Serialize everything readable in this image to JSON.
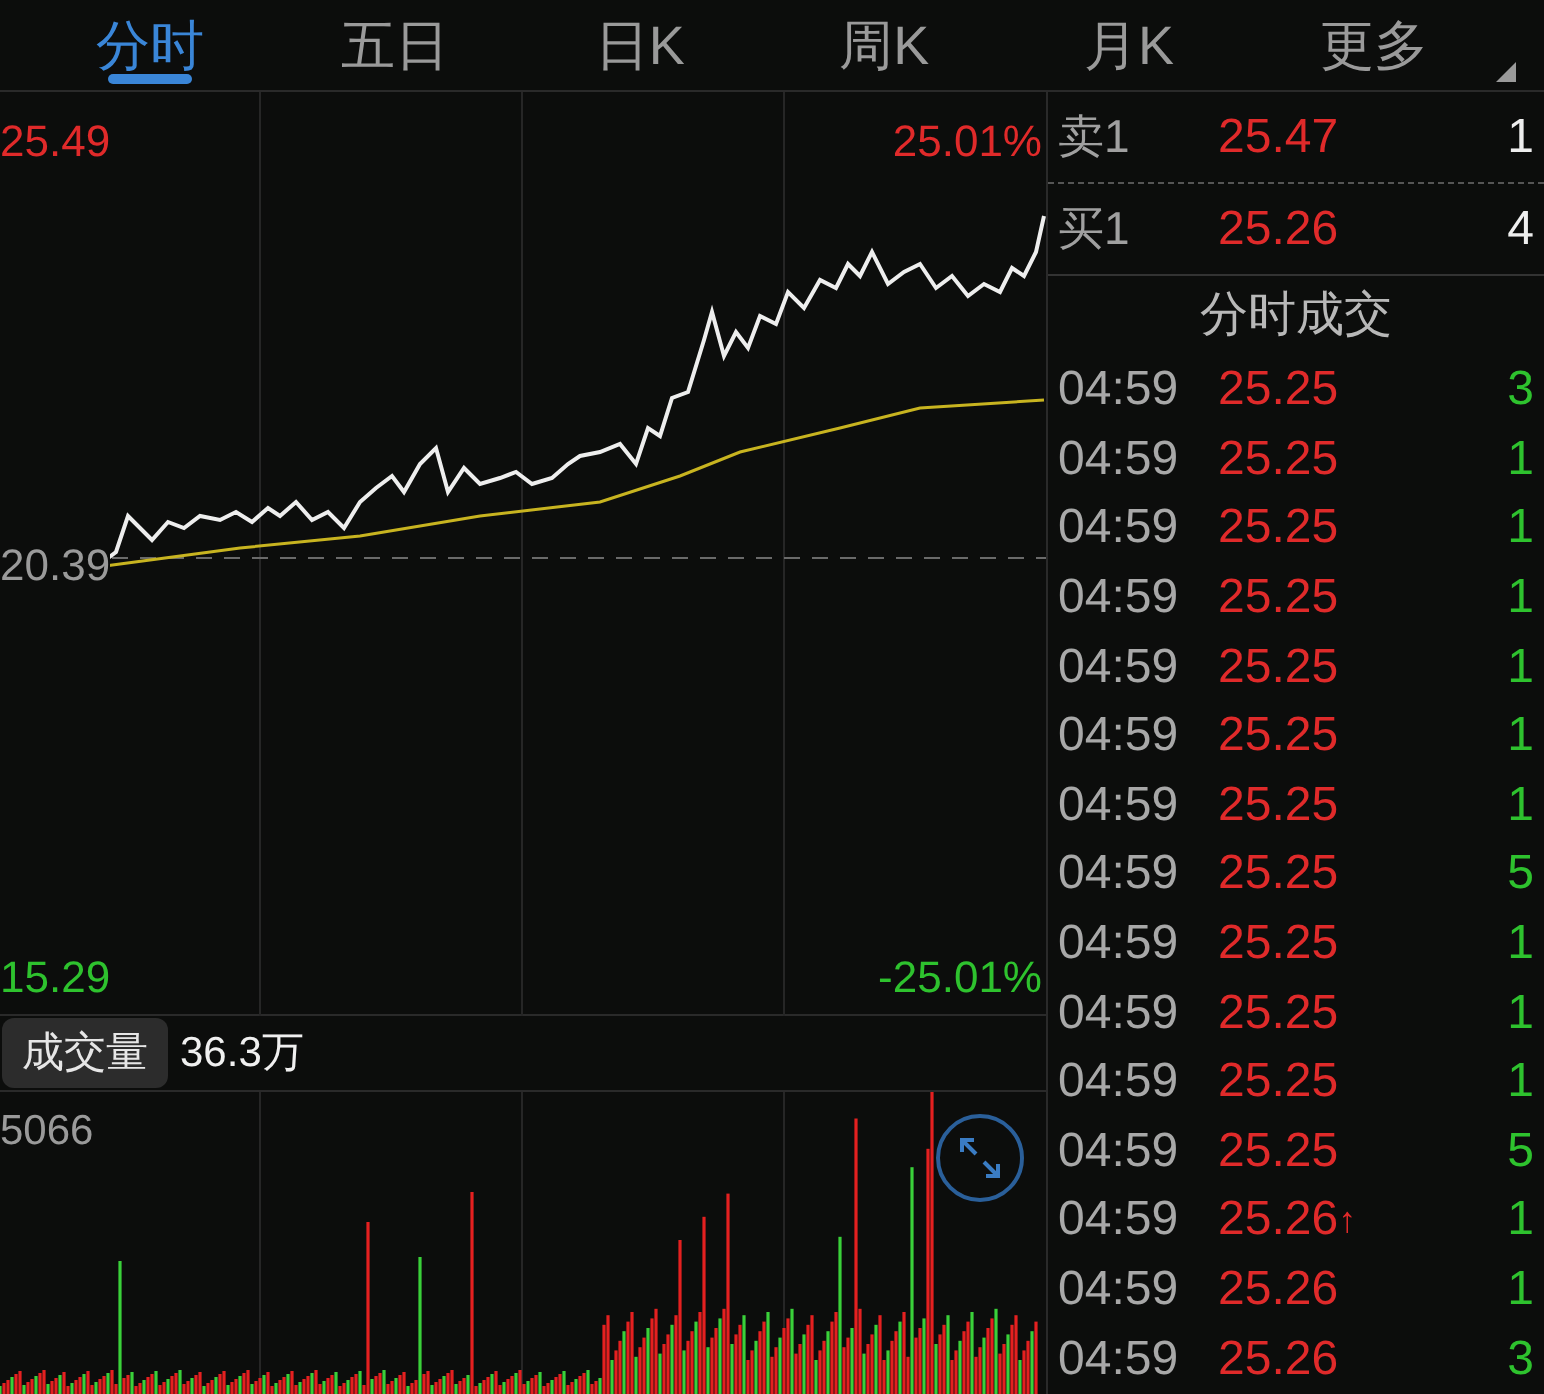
{
  "tabs": [
    {
      "label": "分时",
      "selected": true
    },
    {
      "label": "五日",
      "selected": false
    },
    {
      "label": "日K",
      "selected": false
    },
    {
      "label": "周K",
      "selected": false
    },
    {
      "label": "月K",
      "selected": false
    },
    {
      "label": "更多",
      "selected": false,
      "kind": "menu"
    }
  ],
  "price_chart": {
    "high": "25.49",
    "high_pct": "25.01%",
    "mid": "20.39",
    "low": "15.29",
    "low_pct": "-25.01%"
  },
  "volume": {
    "label": "成交量",
    "total": "36.3万",
    "max": "5066"
  },
  "quotes": [
    {
      "label": "卖1",
      "price": "25.47",
      "qty": "1"
    },
    {
      "label": "买1",
      "price": "25.26",
      "qty": "4"
    }
  ],
  "trades_title": "分时成交",
  "trades": [
    {
      "time": "04:59",
      "price": "25.25",
      "qty": "3"
    },
    {
      "time": "04:59",
      "price": "25.25",
      "qty": "1"
    },
    {
      "time": "04:59",
      "price": "25.25",
      "qty": "1"
    },
    {
      "time": "04:59",
      "price": "25.25",
      "qty": "1"
    },
    {
      "time": "04:59",
      "price": "25.25",
      "qty": "1"
    },
    {
      "time": "04:59",
      "price": "25.25",
      "qty": "1"
    },
    {
      "time": "04:59",
      "price": "25.25",
      "qty": "1"
    },
    {
      "time": "04:59",
      "price": "25.25",
      "qty": "5"
    },
    {
      "time": "04:59",
      "price": "25.25",
      "qty": "1"
    },
    {
      "time": "04:59",
      "price": "25.25",
      "qty": "1"
    },
    {
      "time": "04:59",
      "price": "25.25",
      "qty": "1"
    },
    {
      "time": "04:59",
      "price": "25.25",
      "qty": "5"
    },
    {
      "time": "04:59",
      "price": "25.26",
      "mark": "↑",
      "qty": "1"
    },
    {
      "time": "04:59",
      "price": "25.26",
      "qty": "1"
    },
    {
      "time": "04:59",
      "price": "25.26",
      "qty": "3"
    }
  ]
}
